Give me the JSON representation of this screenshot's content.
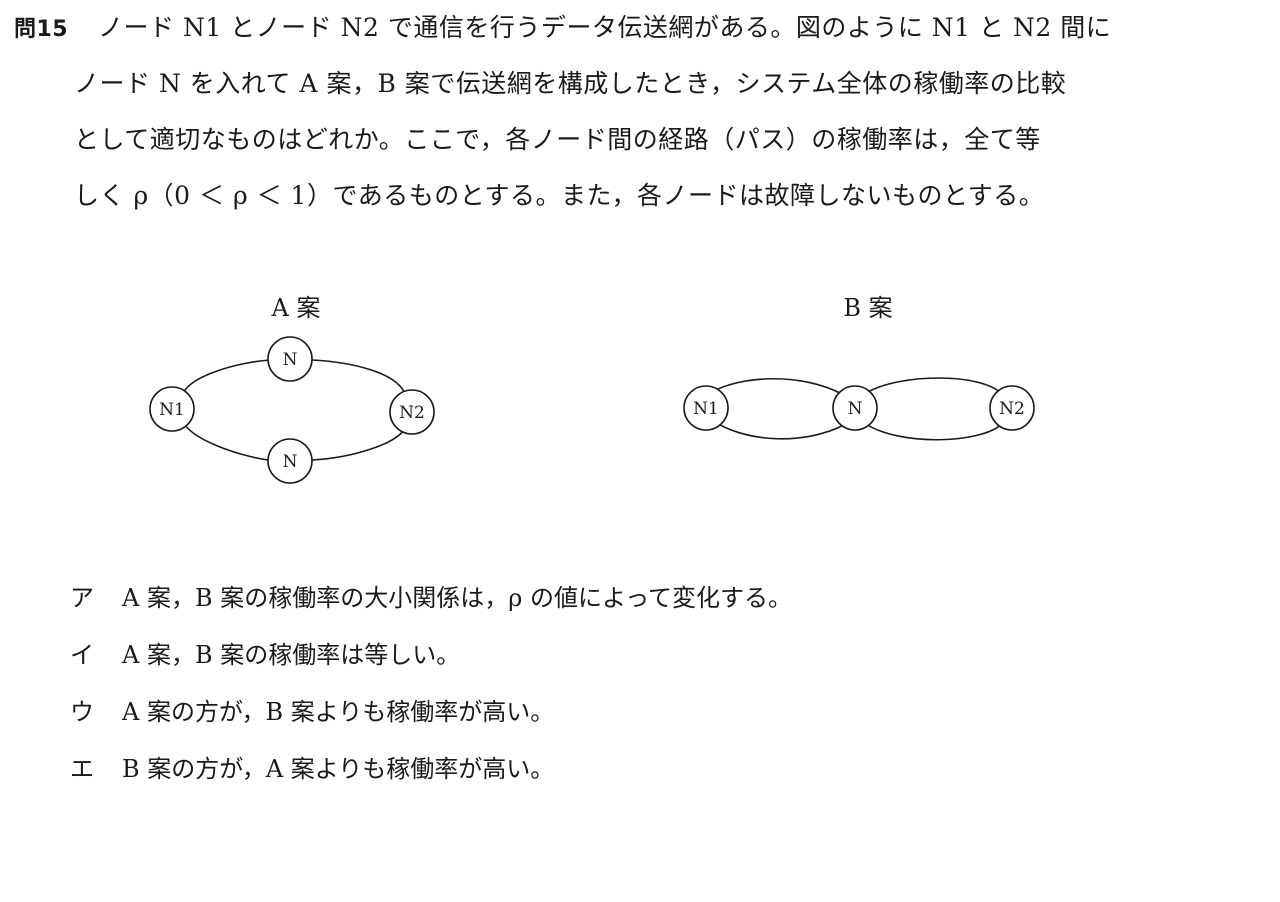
{
  "question": {
    "number": "問15",
    "lines": [
      "ノード N1 とノード N2 で通信を行うデータ伝送網がある。図のように N1 と N2 間に",
      "ノード N を入れて A 案，B 案で伝送網を構成したとき，システム全体の稼働率の比較",
      "として適切なものはどれか。ここで，各ノード間の経路（パス）の稼働率は，全て等",
      "しく ρ（0 ＜ ρ ＜ 1）であるものとする。また，各ノードは故障しないものとする。"
    ]
  },
  "diagram": {
    "plan_a": {
      "title": "A 案",
      "nodes": [
        "N1",
        "N",
        "N",
        "N2"
      ]
    },
    "plan_b": {
      "title": "B 案",
      "nodes": [
        "N1",
        "N",
        "N2"
      ]
    }
  },
  "options": [
    {
      "label": "ア",
      "text": "A 案，B 案の稼働率の大小関係は，ρ の値によって変化する。"
    },
    {
      "label": "イ",
      "text": "A 案，B 案の稼働率は等しい。"
    },
    {
      "label": "ウ",
      "text": "A 案の方が，B 案よりも稼働率が高い。"
    },
    {
      "label": "エ",
      "text": "B 案の方が，A 案よりも稼働率が高い。"
    }
  ],
  "colors": {
    "ink": "#1a1a1a",
    "background": "#ffffff"
  }
}
